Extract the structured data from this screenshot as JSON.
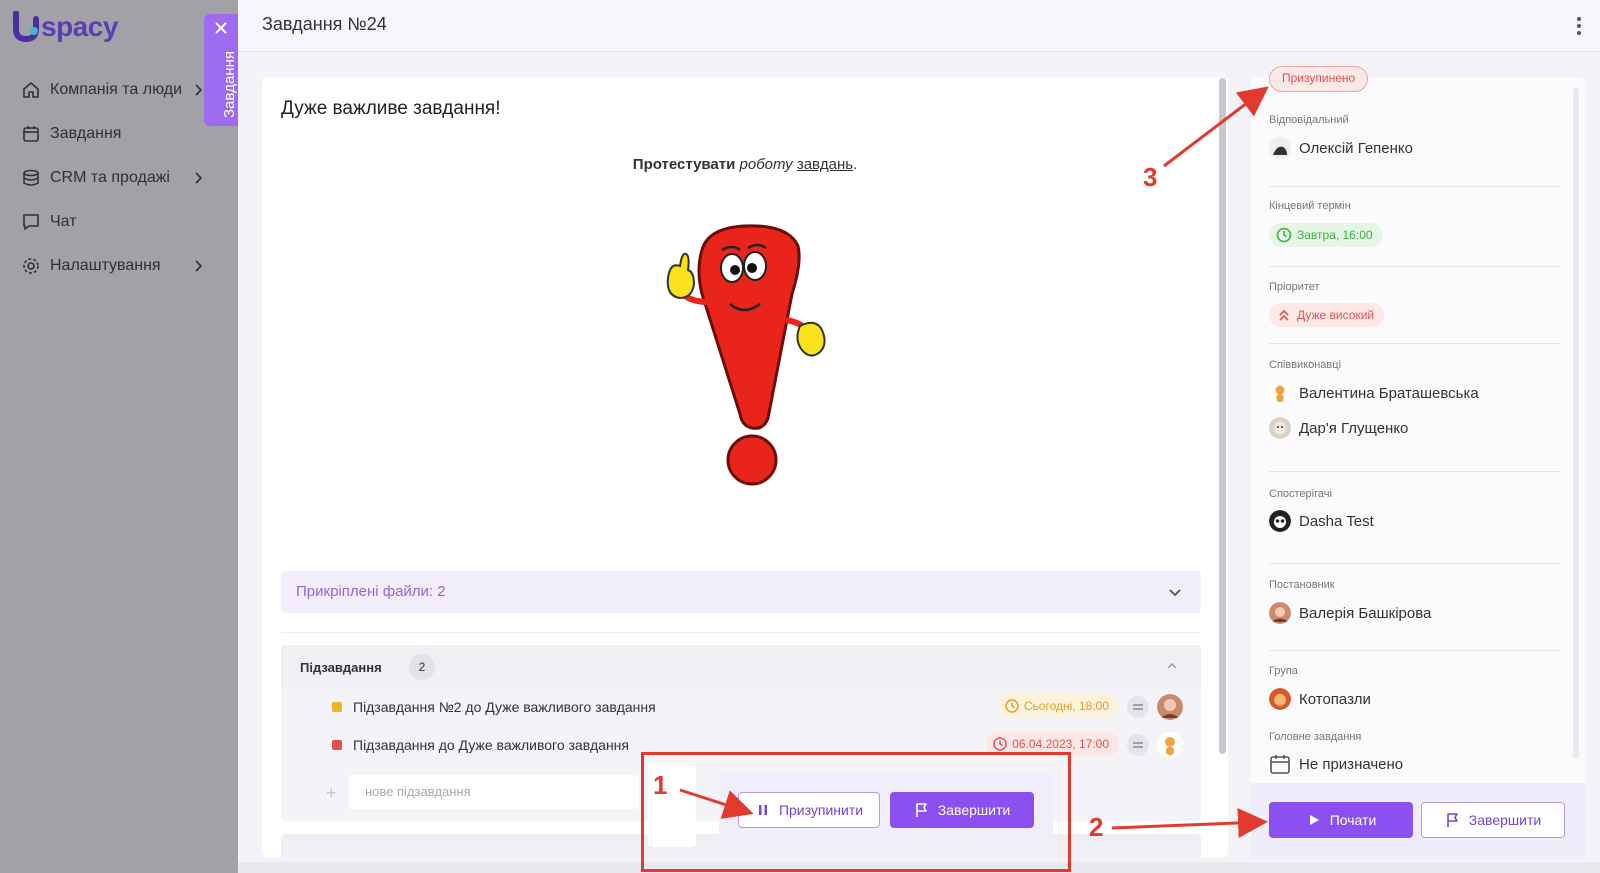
{
  "app": {
    "logo_letter": "U",
    "logo_text": "spacy"
  },
  "sidebar": {
    "items": [
      {
        "label": "Компанія та люди",
        "icon": "home-icon",
        "has_children": true
      },
      {
        "label": "Завдання",
        "icon": "calendar-icon",
        "has_children": false
      },
      {
        "label": "CRM та продажі",
        "icon": "database-icon",
        "has_children": true
      },
      {
        "label": "Чат",
        "icon": "chat-icon",
        "has_children": false
      },
      {
        "label": "Налаштування",
        "icon": "gear-icon",
        "has_children": true
      }
    ],
    "side_tab_label": "Завдання"
  },
  "header": {
    "title": "Завдання №24"
  },
  "task": {
    "title": "Дуже важливе завдання!",
    "description": {
      "bold": "Протестувати",
      "italic": "роботу",
      "underline": "завдань",
      "end": "."
    },
    "attached_files_label": "Прикріплені файли: 2",
    "subtasks": {
      "label": "Підзавдання",
      "count": "2",
      "items": [
        {
          "name": "Підзавдання №2 до Дуже важливого завдання",
          "due": "Сьогодні, 18:00",
          "color": "#f0b429",
          "due_bg": "#fdf3dc",
          "due_fg": "#e0a02a"
        },
        {
          "name": "Підзавдання до Дуже важливого завдання",
          "due": "06.04.2023, 17:00",
          "color": "#e84b4b",
          "due_bg": "#fde6e6",
          "due_fg": "#e25555"
        }
      ],
      "new_placeholder": "нове підзавдання"
    },
    "actions": {
      "pause_label": "Призупинити",
      "finish_label": "Завершити"
    }
  },
  "details": {
    "status": "Призупинено",
    "responsible_label": "Відповідальний",
    "responsible": "Олексій Гепенко",
    "deadline_label": "Кінцевий термін",
    "deadline": "Завтра, 16:00",
    "priority_label": "Пріоритет",
    "priority": "Дуже високий",
    "coexecutors_label": "Співвиконавці",
    "coexecutors": [
      "Валентина Браташевська",
      "Дар'я Глущенко"
    ],
    "observers_label": "Спостерігачі",
    "observers": [
      "Dasha Test"
    ],
    "creator_label": "Постановник",
    "creator": "Валерія Башкірова",
    "group_label": "Група",
    "group": "Котопазли",
    "parent_label": "Головне завдання",
    "parent": "Не призначено",
    "start_label": "Почати",
    "finish_label": "Завершити"
  },
  "annotations": [
    "1",
    "2",
    "3"
  ],
  "colors": {
    "accent": "#8c4ff0",
    "annotation": "#e33a2f",
    "status": "#e05555",
    "deadline": "#3cb043",
    "priority": "#e05555"
  }
}
